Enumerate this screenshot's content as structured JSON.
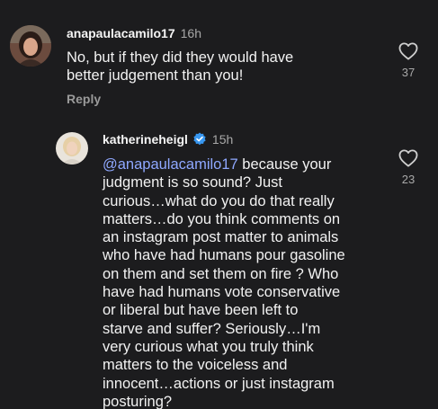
{
  "comments": [
    {
      "username": "anapaulacamilo17",
      "time": "16h",
      "text": "No, but if they did they would have\nbetter judgement than you!",
      "reply_label": "Reply",
      "likes": "37",
      "verified": false
    },
    {
      "username": "katherineheigl",
      "time": "15h",
      "mention": "@anapaulacamilo17",
      "text": " because your\njudgment is so sound? Just\ncurious…what do you do that really\nmatters…do you think comments on\nan instagram post matter to animals\nwho have had humans pour gasoline\non them and set them on fire ? Who\nhave had humans vote conservative\nor liberal but have been left to\nstarve and suffer? Seriously…I'm\nvery curious what you truly think\nmatters to the voiceless and\ninnocent…actions or just instagram\nposturing?",
      "likes": "23",
      "verified": true
    }
  ],
  "colors": {
    "background": "#1c1c1e",
    "mention": "#8fa8ff",
    "verified": "#3897f0"
  },
  "icons": {
    "like": "heart-outline-icon",
    "verified": "verified-badge-icon"
  }
}
